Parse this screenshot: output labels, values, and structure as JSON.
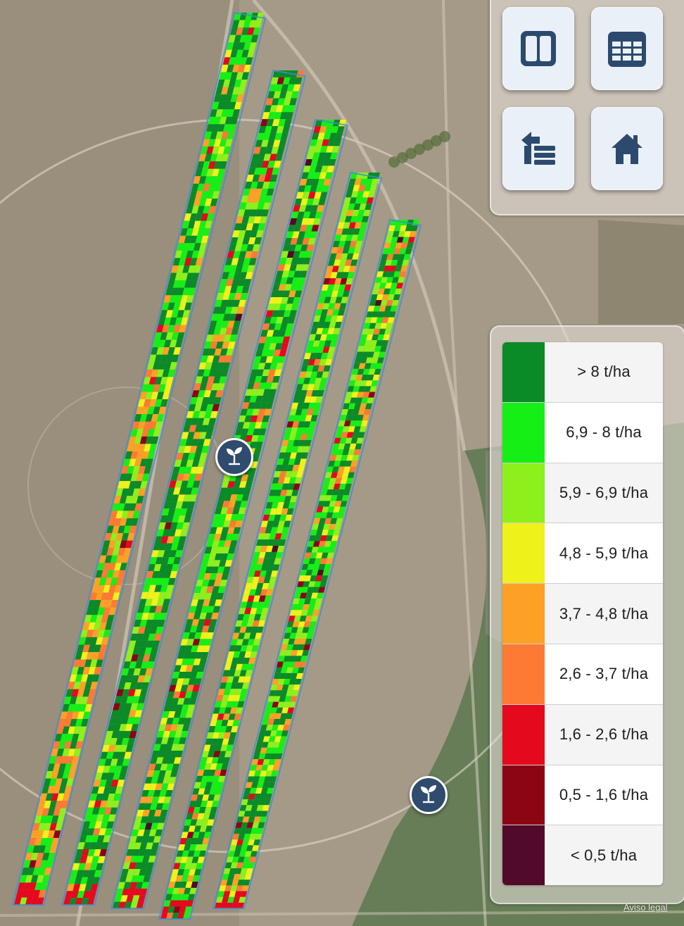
{
  "map": {
    "background_colors": {
      "soil": "#a59a87",
      "field_dark": "#8f8672",
      "crop_green": "#5f7a52",
      "road": "#cfc6b8"
    },
    "strip_outline_color": "#3f8fd3"
  },
  "controls": {
    "split_view": {
      "icon": "split-view-icon"
    },
    "table_view": {
      "icon": "table-icon"
    },
    "layers": {
      "icon": "layers-switch-icon"
    },
    "home": {
      "icon": "home-icon"
    }
  },
  "legend": {
    "items": [
      {
        "label": "> 8 t/ha",
        "color": "#0b8a28"
      },
      {
        "label": "6,9 - 8 t/ha",
        "color": "#16ef16"
      },
      {
        "label": "5,9 - 6,9 t/ha",
        "color": "#8df01c"
      },
      {
        "label": "4,8 - 5,9 t/ha",
        "color": "#eef21a"
      },
      {
        "label": "3,7 - 4,8 t/ha",
        "color": "#fda126"
      },
      {
        "label": "2,6 - 3,7 t/ha",
        "color": "#fd7a35"
      },
      {
        "label": "1,6 - 2,6 t/ha",
        "color": "#e5091d"
      },
      {
        "label": "0,5 - 1,6 t/ha",
        "color": "#8b0514"
      },
      {
        "label": "< 0,5 t/ha",
        "color": "#520a2a"
      }
    ]
  },
  "markers": [
    {
      "icon": "plant-icon"
    },
    {
      "icon": "plant-icon"
    }
  ],
  "footer": {
    "legal_link": "Aviso legal"
  }
}
